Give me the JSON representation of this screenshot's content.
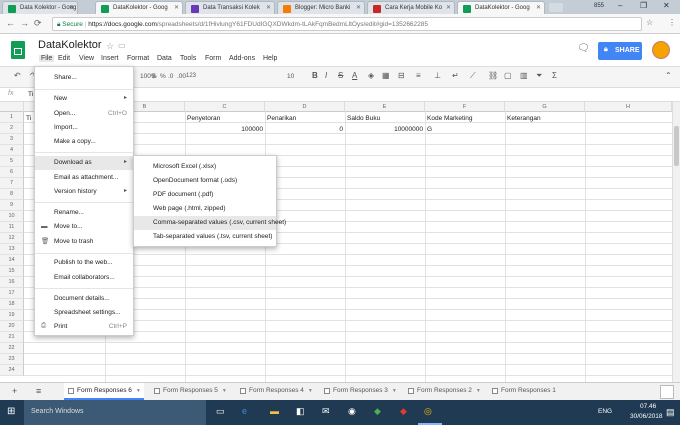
{
  "browser": {
    "tabs": [
      {
        "label": "Data Kolektor - Goog",
        "favicon_color": "#0f9d58"
      },
      {
        "label": "DataKolektor - Goog",
        "favicon_color": "#0f9d58"
      },
      {
        "label": "Data Transaksi Kolek",
        "favicon_color": "#673ab7"
      },
      {
        "label": "Blogger: Micro Banki",
        "favicon_color": "#f57d00"
      },
      {
        "label": "Cara Kerja Mobile Ko",
        "favicon_color": "#c62828"
      },
      {
        "label": "DataKolektor - Goog",
        "favicon_color": "#0f9d58"
      }
    ],
    "secure_label": "Secure",
    "url_host": "https://docs.google.com",
    "url_path": "/spreadsheets/d/1fHivlungY61FDUdIGQXDWkdm-tLAkFqmBedmLltOys/edit#gid=1352662285",
    "ext_count": "855"
  },
  "app": {
    "title": "DataKolektor",
    "menus": [
      "File",
      "Edit",
      "View",
      "Insert",
      "Format",
      "Data",
      "Tools",
      "Form",
      "Add-ons",
      "Help"
    ],
    "share_label": "SHARE"
  },
  "toolbar": {
    "zoom": "100%",
    "currency": "$",
    "percent": "%",
    "dec0": ".0",
    "dec00": ".00",
    "numfmt": "123",
    "font_size": "10",
    "bold": "B",
    "italic": "I",
    "strike": "S",
    "textcolor": "A"
  },
  "formula": {
    "fx": "fx",
    "value": "Ti"
  },
  "grid": {
    "columns": [
      "A",
      "B",
      "C",
      "D",
      "E",
      "F",
      "G",
      "H"
    ],
    "rows": [
      "1",
      "2",
      "3",
      "4",
      "5",
      "6",
      "7",
      "8",
      "9",
      "10",
      "11",
      "12",
      "13",
      "14",
      "15",
      "16",
      "17",
      "18",
      "19",
      "20",
      "21",
      "22",
      "23",
      "24"
    ],
    "headers": {
      "a": "Ti",
      "c": "Penyetoran",
      "d": "Penarikan",
      "e": "Saldo Buku",
      "f": "Kode Marketing",
      "g": "Keterangan"
    },
    "row2": {
      "c": "100000",
      "d": "0",
      "e": "10000000",
      "f": "G"
    }
  },
  "file_menu": {
    "share": "Share...",
    "new": "New",
    "open": "Open...",
    "open_sc": "Ctrl+O",
    "import": "Import...",
    "make_copy": "Make a copy...",
    "download_as": "Download as",
    "email_attachment": "Email as attachment...",
    "version_history": "Version history",
    "rename": "Rename...",
    "move_to": "Move to...",
    "move_trash": "Move to trash",
    "publish": "Publish to the web...",
    "email_collab": "Email collaborators...",
    "doc_details": "Document details...",
    "settings": "Spreadsheet settings...",
    "print": "Print",
    "print_sc": "Ctrl+P"
  },
  "download_submenu": [
    "Microsoft Excel (.xlsx)",
    "OpenDocument format (.ods)",
    "PDF document (.pdf)",
    "Web page (.html, zipped)",
    "Comma-separated values (.csv, current sheet)",
    "Tab-separated values (.tsv, current sheet)"
  ],
  "sheets": {
    "add": "+",
    "list": "≡",
    "tabs": [
      "Form Responses 6",
      "Form Responses 5",
      "Form Responses 4",
      "Form Responses 3",
      "Form Responses 2",
      "Form Responses 1"
    ]
  },
  "taskbar": {
    "search": "Search Windows",
    "lang": "ENG",
    "time": "07.46",
    "date": "30/06/2018"
  }
}
